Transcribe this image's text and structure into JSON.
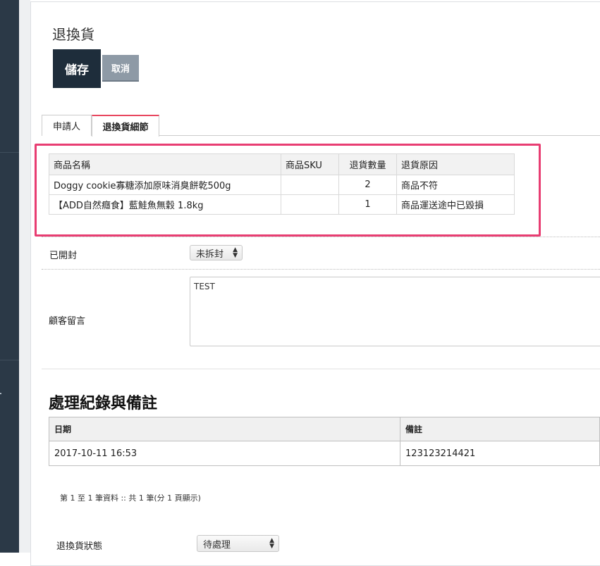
{
  "page": {
    "title": "退換貨"
  },
  "toolbar": {
    "save_label": "儲存",
    "cancel_label": "取消"
  },
  "tabs": [
    {
      "label": "申請人"
    },
    {
      "label": "退換貨細節"
    }
  ],
  "items_table": {
    "headers": [
      "商品名稱",
      "商品SKU",
      "退貨數量",
      "退貨原因"
    ],
    "rows": [
      {
        "name": "Doggy cookie寡糖添加原味消臭餅乾500g",
        "sku": "",
        "qty": "2",
        "reason": "商品不符"
      },
      {
        "name": "【ADD自然癮食】藍鮭魚無穀 1.8kg",
        "sku": "",
        "qty": "1",
        "reason": "商品運送途中已毀損"
      }
    ]
  },
  "opened": {
    "label": "已開封",
    "value": "未拆封"
  },
  "comment": {
    "label": "顧客留言",
    "value": "TEST"
  },
  "log": {
    "title": "處理紀錄與備註",
    "headers": [
      "日期",
      "備註"
    ],
    "rows": [
      {
        "date": "2017-10-11 16:53",
        "note": "123123214421"
      }
    ],
    "pager": "第 1 至 1 筆資料 :: 共 1 筆(分 1 頁顯示)"
  },
  "status": {
    "label": "退換貨狀態",
    "value": "待處理"
  },
  "colors": {
    "accent": "#e83d72",
    "sidebar": "#2b3947",
    "primary_button": "#1e2d3b"
  }
}
